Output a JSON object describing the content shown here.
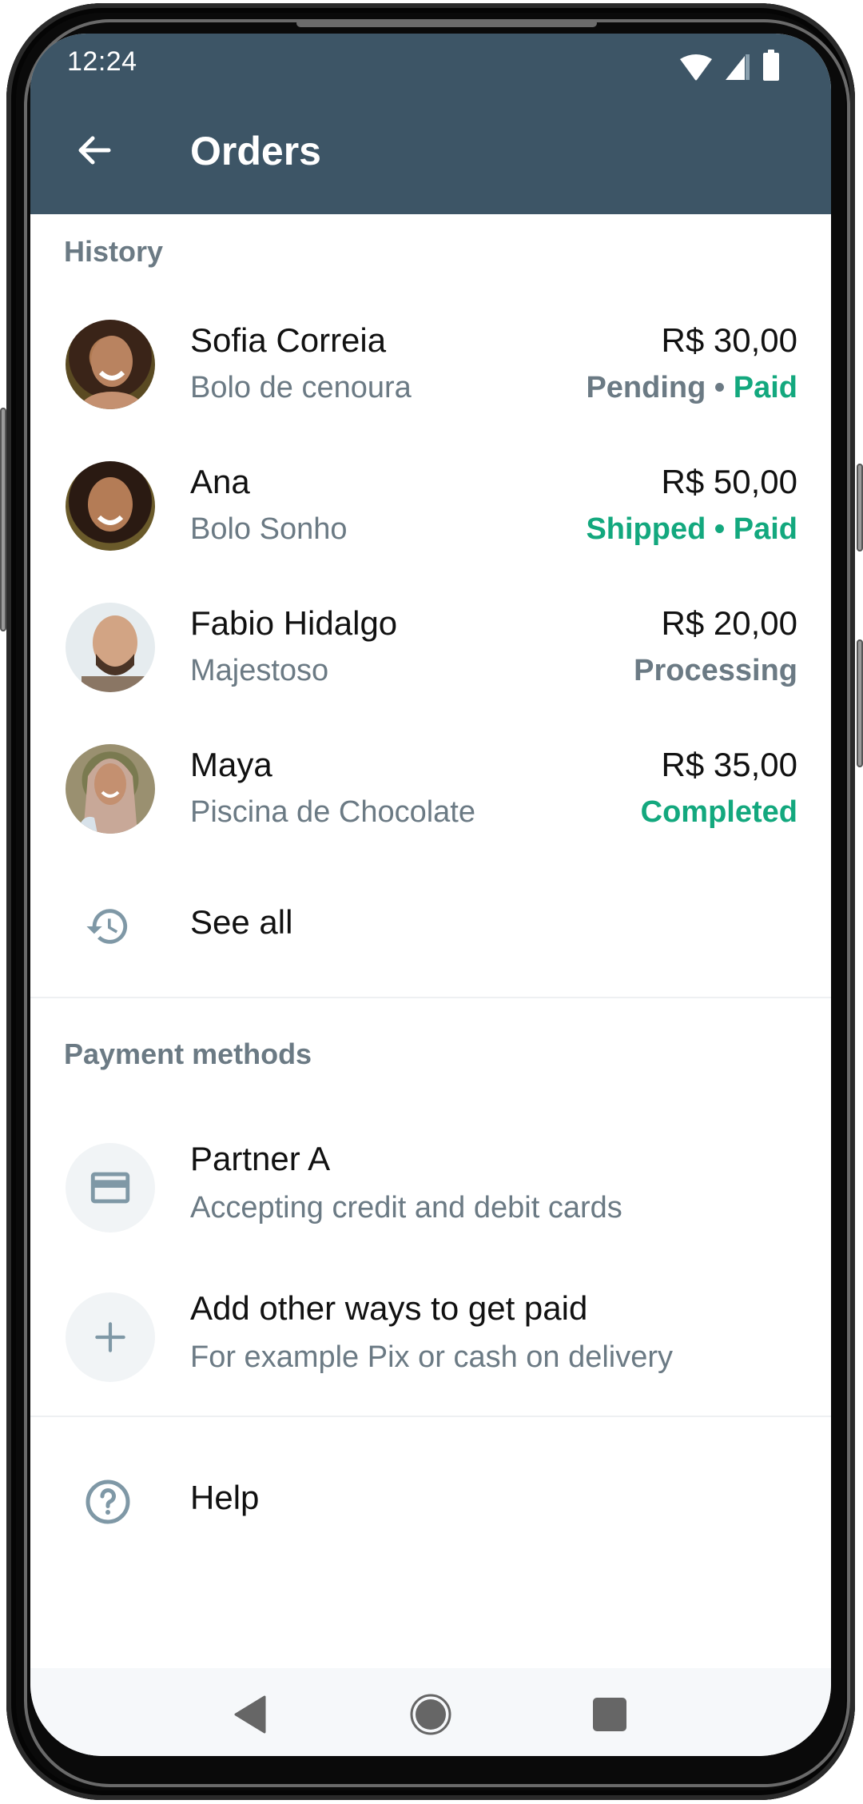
{
  "status_bar": {
    "time": "12:24",
    "icons": [
      "wifi-icon",
      "cellular-signal-icon",
      "battery-icon"
    ]
  },
  "header": {
    "back_icon": "arrow-left-icon",
    "title": "Orders"
  },
  "history": {
    "label": "History",
    "orders": [
      {
        "name": "Sofia Correia",
        "item": "Bolo de cenoura",
        "amount": "R$ 30,00",
        "status_parts": [
          {
            "text": "Pending",
            "tone": "gray"
          },
          {
            "text": " • ",
            "tone": "gray"
          },
          {
            "text": "Paid",
            "tone": "green"
          }
        ]
      },
      {
        "name": "Ana",
        "item": "Bolo Sonho",
        "amount": "R$ 50,00",
        "status_parts": [
          {
            "text": "Shipped",
            "tone": "green"
          },
          {
            "text": " • ",
            "tone": "green"
          },
          {
            "text": "Paid",
            "tone": "green"
          }
        ]
      },
      {
        "name": "Fabio Hidalgo",
        "item": "Majestoso",
        "amount": "R$ 20,00",
        "status_parts": [
          {
            "text": "Processing",
            "tone": "gray"
          }
        ]
      },
      {
        "name": "Maya",
        "item": "Piscina de Chocolate",
        "amount": "R$ 35,00",
        "status_parts": [
          {
            "text": "Completed",
            "tone": "green"
          }
        ]
      }
    ],
    "see_all": {
      "icon": "history-icon",
      "label": "See all"
    }
  },
  "payment_methods": {
    "label": "Payment methods",
    "items": [
      {
        "icon": "credit-card-icon",
        "title": "Partner A",
        "subtitle": "Accepting credit and debit cards"
      },
      {
        "icon": "plus-icon",
        "title": "Add other ways to get paid",
        "subtitle": "For example Pix or cash on delivery"
      }
    ]
  },
  "help": {
    "icon": "help-circle-icon",
    "label": "Help"
  },
  "nav_bar": {
    "buttons": [
      "back-triangle-icon",
      "home-circle-icon",
      "recents-square-icon"
    ]
  },
  "colors": {
    "header_bg": "#3d5566",
    "accent_green": "#13a87e",
    "secondary_text": "#6b7a84",
    "icon_tint": "#7f98a6"
  }
}
